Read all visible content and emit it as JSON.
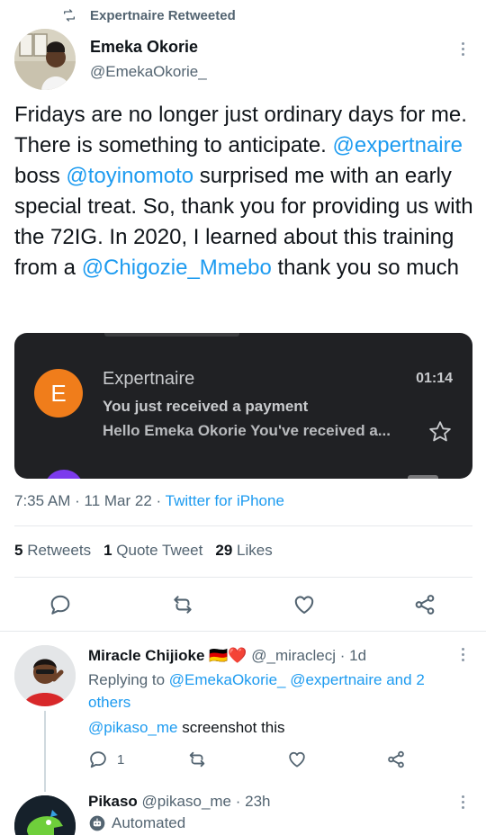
{
  "retweet_banner": {
    "text": "Expertnaire Retweeted",
    "icon": "retweet-icon"
  },
  "tweet": {
    "author_name": "Emeka Okorie",
    "author_handle": "@EmekaOkorie_",
    "text_parts": [
      "Fridays are no longer just ordinary days for me. There is something to anticipate. ",
      "@expertnaire",
      " boss ",
      "@toyinomoto",
      " surprised me with an early special treat. So, thank you for providing us with the 72IG. In 2020, I learned about this training from a ",
      "@Chigozie_Mmebo",
      " thank you so much"
    ],
    "media": {
      "sender_initial": "E",
      "sender": "Expertnaire",
      "time": "01:14",
      "subject": "You just received a payment",
      "preview": "Hello Emeka Okorie You've received a...",
      "avatar_color": "#f07d1b"
    },
    "meta": {
      "time": "7:35 AM",
      "separator": "·",
      "date": "11 Mar 22",
      "source": "Twitter for iPhone"
    },
    "stats": {
      "retweets_count": "5",
      "retweets_label": "Retweets",
      "quotes_count": "1",
      "quotes_label": "Quote Tweet",
      "likes_count": "29",
      "likes_label": "Likes"
    }
  },
  "reply": {
    "name": "Miracle Chijioke",
    "flags": "🇩🇪❤️",
    "handle": "@_miraclecj",
    "age": "· 1d",
    "replying_prefix": "Replying to ",
    "replying_to": "@EmekaOkorie_ @expertnaire and 2 others",
    "mention": "@pikaso_me",
    "body": " screenshot this",
    "reply_count": "1"
  },
  "next_tweet": {
    "name": "Pikaso",
    "handle": "@pikaso_me",
    "age": "· 23h",
    "badge": "Automated"
  },
  "colors": {
    "accent": "#1d9bf0",
    "muted": "#536471",
    "card_bg": "#202124"
  }
}
